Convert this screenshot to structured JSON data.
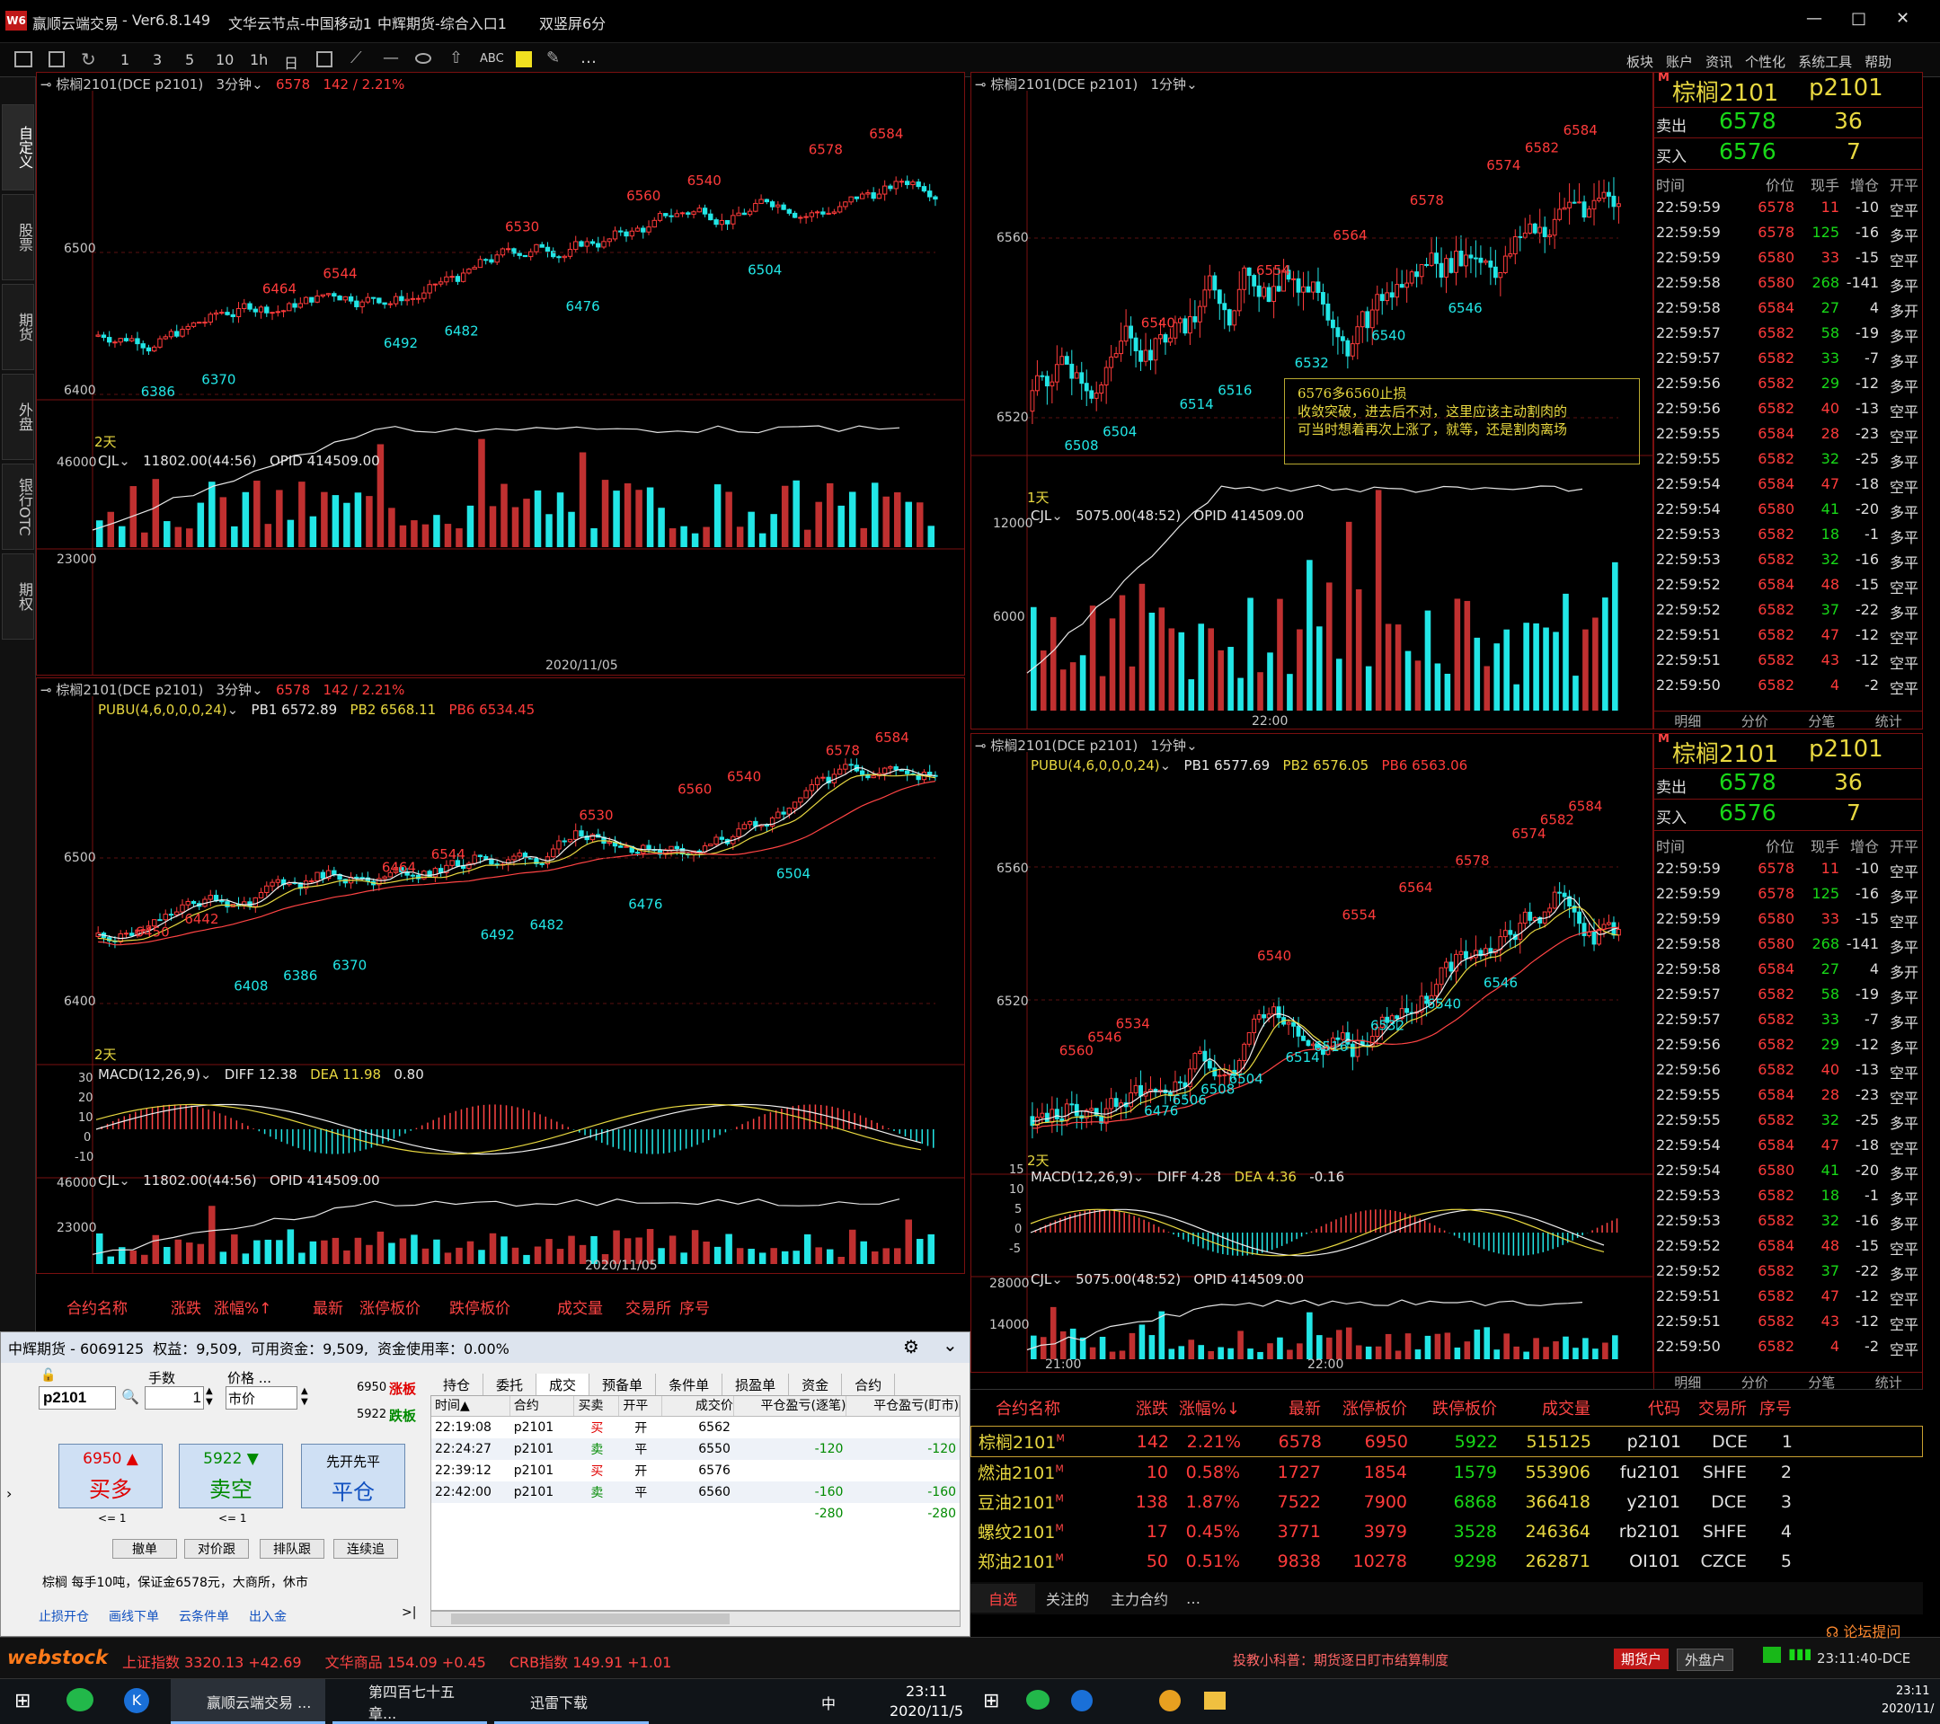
{
  "app": {
    "logo": "W6",
    "title": "赢顺云端交易",
    "version": "Ver6.8.149",
    "node": "文华云节点-中国移动1",
    "broker_entry": "中辉期货-综合入口1",
    "layout": "双竖屏6分",
    "window_buttons": [
      "—",
      "□",
      "✕"
    ]
  },
  "toolbar": {
    "periods": [
      "1",
      "3",
      "5",
      "10",
      "1h",
      "日"
    ],
    "tools": [
      "ABC",
      "…"
    ],
    "right_menu": [
      "板块",
      "账户",
      "资讯",
      "个性化",
      "系统工具",
      "帮助"
    ]
  },
  "sidebar": {
    "tabs": [
      "自定义",
      "股票",
      "期货",
      "外盘",
      "银行OTC",
      "期权"
    ]
  },
  "chart_tl": {
    "header": {
      "name": "棕榈2101(DCE p2101)",
      "period": "3分钟",
      "price": "6578",
      "change": "142 / 2.21%"
    },
    "price_ticks": [
      6500,
      6400
    ],
    "days_label": "2天",
    "date_label": "2020/11/05",
    "annotations": [
      {
        "v": "6386",
        "c": "cyan"
      },
      {
        "v": "6370",
        "c": "cyan"
      },
      {
        "v": "6464",
        "c": "red"
      },
      {
        "v": "6544",
        "c": "red"
      },
      {
        "v": "6492",
        "c": "cyan"
      },
      {
        "v": "6482",
        "c": "cyan"
      },
      {
        "v": "6530",
        "c": "red"
      },
      {
        "v": "6476",
        "c": "cyan"
      },
      {
        "v": "6560",
        "c": "red"
      },
      {
        "v": "6540",
        "c": "red"
      },
      {
        "v": "6504",
        "c": "cyan"
      },
      {
        "v": "6578",
        "c": "red"
      },
      {
        "v": "6584",
        "c": "red"
      }
    ],
    "vol_header": {
      "name": "CJL",
      "value": "11802.00(44:56)",
      "opid": "OPID 414509.00"
    },
    "vol_ticks": [
      46000,
      23000
    ]
  },
  "chart_bl": {
    "header": {
      "name": "棕榈2101(DCE p2101)",
      "period": "3分钟",
      "price": "6578",
      "change": "142 / 2.21%"
    },
    "pubu": {
      "name": "PUBU(4,6,0,0,0,24)",
      "pb1": "PB1 6572.89",
      "pb2": "PB2 6568.11",
      "pb6": "PB6 6534.45"
    },
    "price_ticks": [
      6500,
      6400
    ],
    "days_label": "2天",
    "annotations": [
      {
        "v": "6450",
        "c": "red"
      },
      {
        "v": "6442",
        "c": "red"
      },
      {
        "v": "6408",
        "c": "cyan"
      },
      {
        "v": "6386",
        "c": "cyan"
      },
      {
        "v": "6370",
        "c": "cyan"
      },
      {
        "v": "6464",
        "c": "red"
      },
      {
        "v": "6544",
        "c": "red"
      },
      {
        "v": "6492",
        "c": "cyan"
      },
      {
        "v": "6482",
        "c": "cyan"
      },
      {
        "v": "6530",
        "c": "red"
      },
      {
        "v": "6476",
        "c": "cyan"
      },
      {
        "v": "6560",
        "c": "red"
      },
      {
        "v": "6540",
        "c": "red"
      },
      {
        "v": "6504",
        "c": "cyan"
      },
      {
        "v": "6578",
        "c": "red"
      },
      {
        "v": "6584",
        "c": "red"
      }
    ],
    "macd": {
      "name": "MACD(12,26,9)",
      "diff": "DIFF 12.38",
      "dea": "DEA 11.98",
      "macd": "0.80",
      "ticks": [
        "30",
        "20",
        "10",
        "0",
        "-10"
      ]
    },
    "vol_header": {
      "name": "CJL",
      "value": "11802.00(44:56)",
      "opid": "OPID 414509.00"
    },
    "vol_ticks": [
      46000,
      23000
    ],
    "date_label": "2020/11/05"
  },
  "chart_tr": {
    "header": {
      "name": "棕榈2101(DCE p2101)",
      "period": "1分钟"
    },
    "price_ticks": [
      6560,
      6520
    ],
    "days_label": "1天",
    "annotations": [
      {
        "v": "6508",
        "c": "cyan"
      },
      {
        "v": "6504",
        "c": "cyan"
      },
      {
        "v": "6540",
        "c": "red"
      },
      {
        "v": "6514",
        "c": "cyan"
      },
      {
        "v": "6516",
        "c": "cyan"
      },
      {
        "v": "6554",
        "c": "red"
      },
      {
        "v": "6532",
        "c": "cyan"
      },
      {
        "v": "6564",
        "c": "red"
      },
      {
        "v": "6540",
        "c": "cyan"
      },
      {
        "v": "6578",
        "c": "red"
      },
      {
        "v": "6546",
        "c": "cyan"
      },
      {
        "v": "6574",
        "c": "red"
      },
      {
        "v": "6582",
        "c": "red"
      },
      {
        "v": "6584",
        "c": "red"
      }
    ],
    "note": [
      "6576多6560止损",
      "收敛突破，进去后不对，这里应该主动割肉的",
      "可当时想着再次上涨了，就等，还是割肉离场"
    ],
    "vol_header": {
      "name": "CJL",
      "value": "5075.00(48:52)",
      "opid": "OPID 414509.00"
    },
    "vol_ticks": [
      12000,
      6000
    ],
    "time_label": "22:00"
  },
  "chart_br": {
    "header": {
      "name": "棕榈2101(DCE p2101)",
      "period": "1分钟"
    },
    "pubu": {
      "name": "PUBU(4,6,0,0,0,24)",
      "pb1": "PB1 6577.69",
      "pb2": "PB2 6576.05",
      "pb6": "PB6 6563.06"
    },
    "price_ticks": [
      6560,
      6520
    ],
    "days_label": "2天",
    "annotations": [
      {
        "v": "6560",
        "c": "red"
      },
      {
        "v": "6546",
        "c": "red"
      },
      {
        "v": "6534",
        "c": "red"
      },
      {
        "v": "6476",
        "c": "cyan"
      },
      {
        "v": "6506",
        "c": "cyan"
      },
      {
        "v": "6508",
        "c": "cyan"
      },
      {
        "v": "6504",
        "c": "cyan"
      },
      {
        "v": "6540",
        "c": "red"
      },
      {
        "v": "6514",
        "c": "cyan"
      },
      {
        "v": "6516",
        "c": "cyan"
      },
      {
        "v": "6554",
        "c": "red"
      },
      {
        "v": "6532",
        "c": "cyan"
      },
      {
        "v": "6564",
        "c": "red"
      },
      {
        "v": "6540",
        "c": "cyan"
      },
      {
        "v": "6578",
        "c": "red"
      },
      {
        "v": "6546",
        "c": "cyan"
      },
      {
        "v": "6574",
        "c": "red"
      },
      {
        "v": "6582",
        "c": "red"
      },
      {
        "v": "6584",
        "c": "red"
      }
    ],
    "macd": {
      "name": "MACD(12,26,9)",
      "diff": "DIFF 4.28",
      "dea": "DEA 4.36",
      "macd": "-0.16",
      "ticks": [
        "15",
        "10",
        "5",
        "0",
        "-5"
      ]
    },
    "vol_header": {
      "name": "CJL",
      "value": "5075.00(48:52)",
      "opid": "OPID 414509.00"
    },
    "vol_ticks": [
      28000,
      14000
    ],
    "time_labels": [
      "21:00",
      "22:00"
    ]
  },
  "quote": {
    "mark": "M",
    "name": "棕榈2101",
    "code": "p2101",
    "sell_label": "卖出",
    "sell_price": "6578",
    "sell_vol": "36",
    "buy_label": "买入",
    "buy_price": "6576",
    "buy_vol": "7",
    "cols": [
      "时间",
      "价位",
      "现手",
      "增仓",
      "开平"
    ],
    "ticks": [
      [
        "22:59:59",
        "6578",
        "11",
        "-10",
        "空平"
      ],
      [
        "22:59:59",
        "6578",
        "125",
        "-16",
        "多平"
      ],
      [
        "22:59:59",
        "6580",
        "33",
        "-15",
        "空平"
      ],
      [
        "22:59:58",
        "6580",
        "268",
        "-141",
        "多平"
      ],
      [
        "22:59:58",
        "6584",
        "27",
        "4",
        "多开"
      ],
      [
        "22:59:57",
        "6582",
        "58",
        "-19",
        "多平"
      ],
      [
        "22:59:57",
        "6582",
        "33",
        "-7",
        "多平"
      ],
      [
        "22:59:56",
        "6582",
        "29",
        "-12",
        "多平"
      ],
      [
        "22:59:56",
        "6582",
        "40",
        "-13",
        "空平"
      ],
      [
        "22:59:55",
        "6584",
        "28",
        "-23",
        "空平"
      ],
      [
        "22:59:55",
        "6582",
        "32",
        "-25",
        "多平"
      ],
      [
        "22:59:54",
        "6584",
        "47",
        "-18",
        "空平"
      ],
      [
        "22:59:54",
        "6580",
        "41",
        "-20",
        "多平"
      ],
      [
        "22:59:53",
        "6582",
        "18",
        "-1",
        "多平"
      ],
      [
        "22:59:53",
        "6582",
        "32",
        "-16",
        "多平"
      ],
      [
        "22:59:52",
        "6584",
        "48",
        "-15",
        "空平"
      ],
      [
        "22:59:52",
        "6582",
        "37",
        "-22",
        "多平"
      ],
      [
        "22:59:51",
        "6582",
        "47",
        "-12",
        "空平"
      ],
      [
        "22:59:51",
        "6582",
        "43",
        "-12",
        "空平"
      ],
      [
        "22:59:50",
        "6582",
        "4",
        "-2",
        "空平"
      ]
    ],
    "bottom_tabs": [
      "明细",
      "分价",
      "分笔",
      "统计"
    ]
  },
  "list_left_header": [
    "合约名称",
    "涨跌",
    "涨幅%↑",
    "最新",
    "涨停板价",
    "跌停板价",
    "成交量",
    "交易所",
    "序号"
  ],
  "watchlist": {
    "header": [
      "合约名称",
      "涨跌",
      "涨幅%↓",
      "最新",
      "涨停板价",
      "跌停板价",
      "成交量",
      "代码",
      "交易所",
      "序号"
    ],
    "rows": [
      [
        "棕榈2101",
        "142",
        "2.21%",
        "6578",
        "6950",
        "5922",
        "515125",
        "p2101",
        "DCE",
        "1"
      ],
      [
        "燃油2101",
        "10",
        "0.58%",
        "1727",
        "1854",
        "1579",
        "553906",
        "fu2101",
        "SHFE",
        "2"
      ],
      [
        "豆油2101",
        "138",
        "1.87%",
        "7522",
        "7900",
        "6868",
        "366418",
        "y2101",
        "DCE",
        "3"
      ],
      [
        "螺纹2101",
        "17",
        "0.45%",
        "3771",
        "3979",
        "3528",
        "246364",
        "rb2101",
        "SHFE",
        "4"
      ],
      [
        "郑油2101",
        "50",
        "0.51%",
        "9838",
        "10278",
        "9298",
        "262871",
        "OI101",
        "CZCE",
        "5"
      ]
    ],
    "row_mark": "M",
    "tabs": [
      "自选",
      "关注的",
      "主力合约",
      "…"
    ]
  },
  "order": {
    "account": "中辉期货 - 6069125",
    "equity": "权益：9,509,",
    "available": "可用资金：9,509,",
    "usage": "资金使用率：0.00%",
    "contract_label": "",
    "contract": "p2101",
    "qty_label": "手数",
    "qty": "1",
    "price_label": "价格 ...",
    "price_mode": "市价",
    "limit_up": "6950",
    "limit_up_label": "涨板",
    "limit_down": "5922",
    "limit_down_label": "跌板",
    "buy_price": "6950",
    "buy_label": "买多",
    "buy_sub": "<= 1",
    "sell_price": "5922",
    "sell_label": "卖空",
    "sell_sub": "<= 1",
    "close_top": "先开先平",
    "close_label": "平仓",
    "actions": [
      "撤单",
      "对价跟",
      "排队跟",
      "连续追"
    ],
    "info": "棕榈 每手10吨，保证金6578元，大商所，休市",
    "links": [
      "止损开仓",
      "画线下单",
      "云条件单",
      "出入金"
    ],
    "tabs": [
      "持仓",
      "委托",
      "成交",
      "预备单",
      "条件单",
      "损盈单",
      "资金",
      "合约"
    ],
    "trade_cols": [
      "时间▲",
      "合约",
      "买卖",
      "开平",
      "成交价",
      "平仓盈亏(逐笔)",
      "平仓盈亏(盯市)"
    ],
    "trades": [
      [
        "22:19:08",
        "p2101",
        "买",
        "开",
        "6562",
        "",
        ""
      ],
      [
        "22:24:27",
        "p2101",
        "卖",
        "平",
        "6550",
        "-120",
        "-120"
      ],
      [
        "22:39:12",
        "p2101",
        "买",
        "开",
        "6576",
        "",
        ""
      ],
      [
        "22:42:00",
        "p2101",
        "卖",
        "平",
        "6560",
        "-160",
        "-160"
      ]
    ],
    "trade_total": [
      "-280",
      "-280"
    ]
  },
  "status": {
    "brand": "webstock",
    "indices": [
      {
        "name": "上证指数",
        "val": "3320.13",
        "chg": "+42.69"
      },
      {
        "name": "文华商品",
        "val": "154.09",
        "chg": "+0.45"
      },
      {
        "name": "CRB指数",
        "val": "149.91",
        "chg": "+1.01"
      }
    ],
    "tip": "投教小科普：期货逐日盯市结算制度",
    "btn_futures": "期货户",
    "btn_foreign": "外盘户",
    "clock": "23:11:40-DCE",
    "forum": "论坛提问"
  },
  "taskbar": {
    "items": [
      "赢顺云端交易 ...",
      "第四百七十五章...",
      "迅雷下载"
    ],
    "ime": "中",
    "time": "23:11",
    "date": "2020/11/5",
    "time2": "23:11",
    "date2": "2020/11/"
  },
  "colors": {
    "up": "#ff3b3b",
    "down": "#22e6e6",
    "frame": "#7a1010",
    "yellow": "#e8d840"
  }
}
